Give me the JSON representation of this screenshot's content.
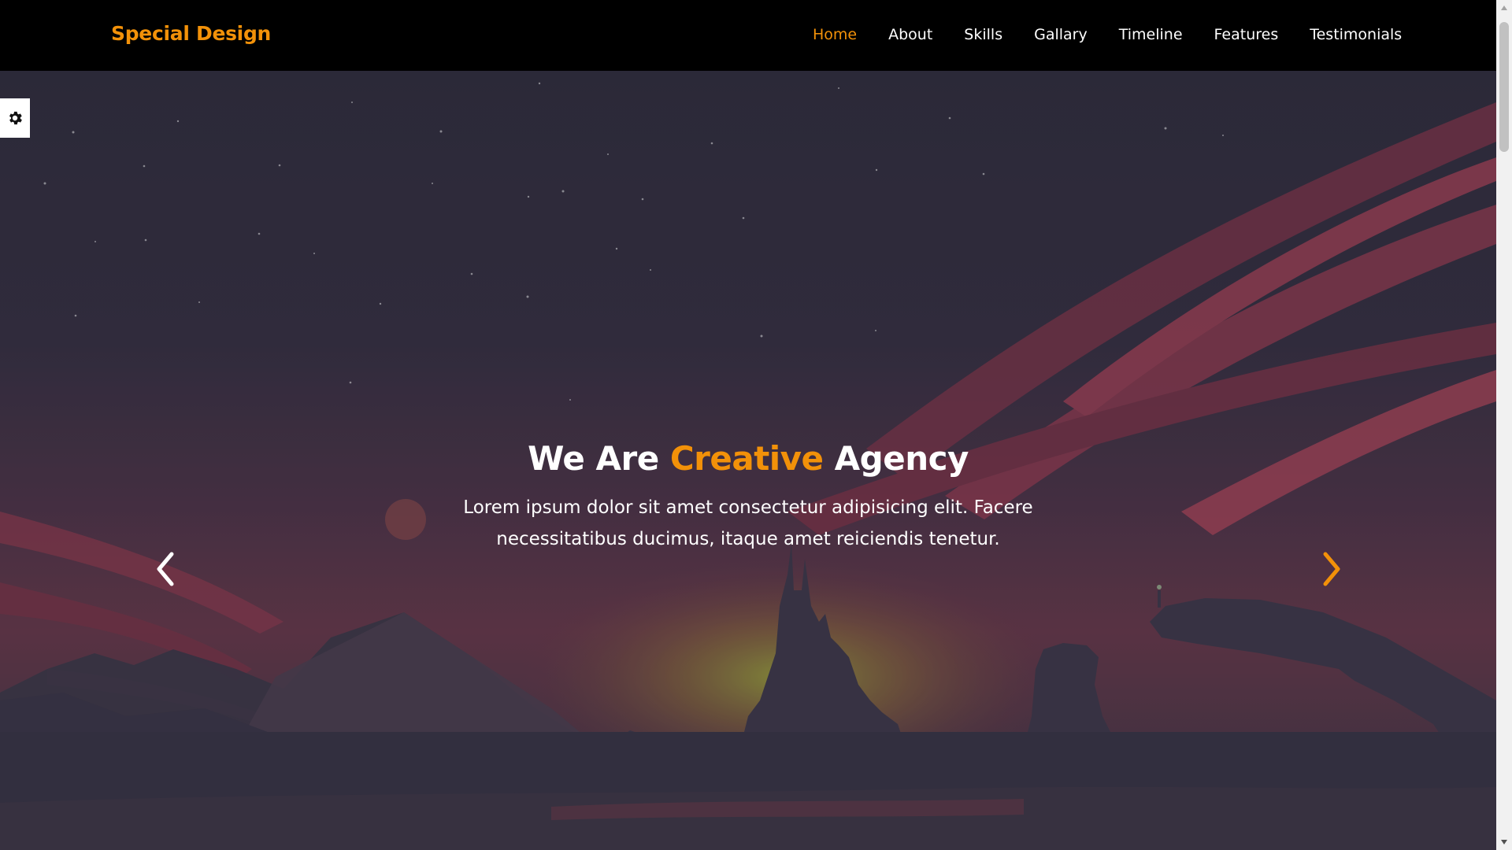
{
  "header": {
    "logo": "Special Design",
    "nav": [
      "Home",
      "About",
      "Skills",
      "Gallary",
      "Timeline",
      "Features",
      "Testimonials"
    ],
    "active_index": 0
  },
  "hero": {
    "title_before": "We Are ",
    "title_highlight": "Creative",
    "title_after": " Agency",
    "description": "Lorem ipsum dolor sit amet consectetur adipisicing elit. Facere necessitatibus ducimus, itaque amet reiciendis tenetur."
  },
  "icons": {
    "settings": "gear-icon",
    "prev": "chevron-left-icon",
    "next": "chevron-right-icon"
  },
  "colors": {
    "accent": "#f29109",
    "header_bg": "#000000",
    "text": "#ffffff",
    "overlay": "#2e2e3e"
  }
}
